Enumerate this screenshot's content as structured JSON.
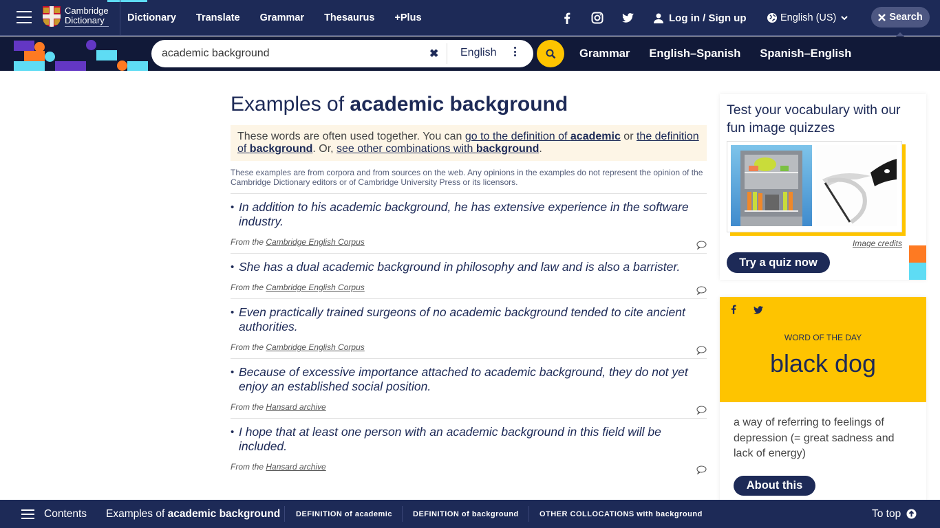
{
  "header": {
    "logo_line1": "Cambridge",
    "logo_line2": "Dictionary",
    "nav": [
      "Dictionary",
      "Translate",
      "Grammar",
      "Thesaurus",
      "+Plus"
    ],
    "active_nav": "Dictionary",
    "login_label": "Log in / Sign up",
    "language_label": "English (US)",
    "search_toggle_label": "Search"
  },
  "searchbar": {
    "query": "academic background",
    "dictionary": "English",
    "links": [
      "Grammar",
      "English–Spanish",
      "Spanish–English"
    ]
  },
  "main": {
    "title_prefix": "Examples of ",
    "title_term": "academic background",
    "note": {
      "text1": "These words are often used together. You can ",
      "link1_prefix": "go to the definition of ",
      "link1_term": "academic",
      "text2": " or ",
      "link2_prefix": "the definition of ",
      "link2_term": "background",
      "text3": ". Or, ",
      "link3_prefix": "see other combinations with ",
      "link3_term": "background",
      "text4": "."
    },
    "disclaimer": "These examples are from corpora and from sources on the web. Any opinions in the examples do not represent the opinion of the Cambridge Dictionary editors or of Cambridge University Press or its licensors.",
    "source_prefix": "From the ",
    "examples": [
      {
        "sentence": "In addition to his academic background, he has extensive experience in the software industry.",
        "source": "Cambridge English Corpus"
      },
      {
        "sentence": "She has a dual academic background in philosophy and law and is also a barrister.",
        "source": "Cambridge English Corpus"
      },
      {
        "sentence": "Even practically trained surgeons of no academic background tended to cite ancient authorities.",
        "source": "Cambridge English Corpus"
      },
      {
        "sentence": "Because of excessive importance attached to academic background, they do not yet enjoy an established social position.",
        "source": "Hansard archive"
      },
      {
        "sentence": "I hope that at least one person with an academic background in this field will be included.",
        "source": "Hansard archive"
      }
    ]
  },
  "quiz": {
    "title": "Test your vocabulary with our fun image quizzes",
    "credits": "Image credits",
    "button": "Try a quiz now"
  },
  "wotd": {
    "label": "WORD OF THE DAY",
    "word": "black dog",
    "definition": "a way of referring to feelings of depression (= great sadness and lack of energy)",
    "button": "About this"
  },
  "bottombar": {
    "contents": "Contents",
    "current_prefix": "Examples of ",
    "current_term": "academic background",
    "links": [
      "DEFINITION of academic",
      "DEFINITION of background",
      "OTHER COLLOCATIONS with background"
    ],
    "to_top": "To top"
  },
  "colors": {
    "navy": "#1d2a57",
    "dark_navy": "#111938",
    "yellow": "#fec400",
    "orange": "#fe7a22",
    "cyan": "#5edcf4",
    "purple": "#6337c4"
  }
}
